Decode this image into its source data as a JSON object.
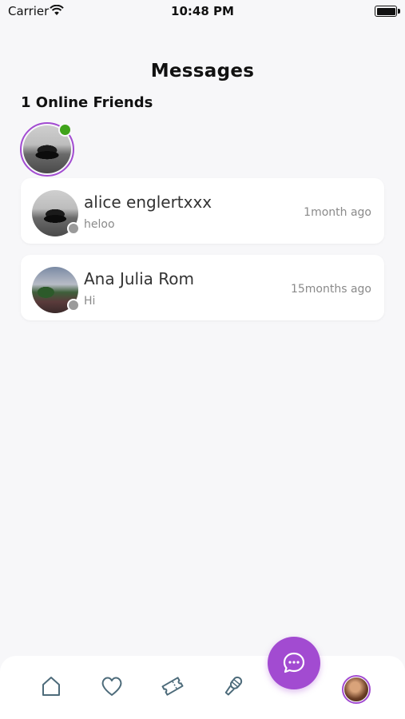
{
  "status_bar": {
    "carrier": "Carrier",
    "time": "10:48 PM"
  },
  "header": {
    "title": "Messages"
  },
  "online_friends": {
    "heading": "1 Online Friends"
  },
  "conversations": [
    {
      "name": "alice englertxxx",
      "preview": "heloo",
      "time": "1month ago"
    },
    {
      "name": "Ana Julia Rom",
      "preview": "Hi",
      "time": "15months ago"
    }
  ],
  "tab_bar": {
    "tabs": [
      "home-icon",
      "heart-icon",
      "ticket-icon",
      "microphone-icon",
      "chat-icon",
      "profile-avatar"
    ]
  },
  "colors": {
    "accent": "#a24bd1",
    "online": "#3fa31a",
    "offline": "#9a9a9a",
    "icon": "#4d6b7a"
  }
}
